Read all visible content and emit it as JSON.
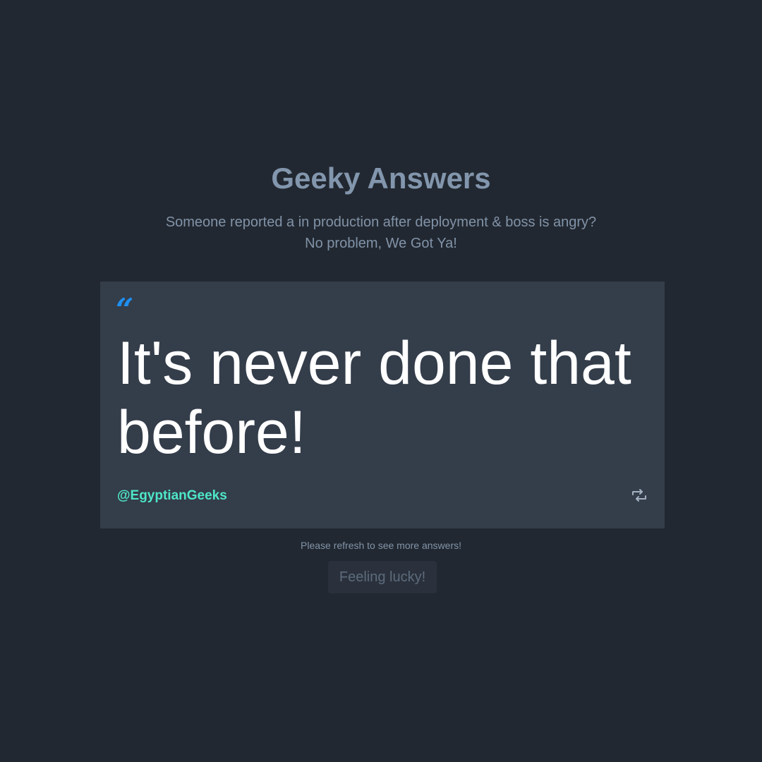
{
  "header": {
    "title": "Geeky Answers",
    "subtitle_line1": "Someone reported a in production after deployment & boss is angry?",
    "subtitle_line2": "No problem, We Got Ya!"
  },
  "card": {
    "quote_icon": "quote-open-icon",
    "quote": "It's never done that before!",
    "author": "@EgyptianGeeks",
    "share_icon": "retweet-icon"
  },
  "footer": {
    "hint": "Please refresh to see more answers!",
    "button_label": "Feeling lucky!"
  },
  "colors": {
    "background": "#222831",
    "card": "#343d4a",
    "accent_quote": "#1e8ff0",
    "author": "#4ee6c8",
    "muted": "#8193a8"
  }
}
